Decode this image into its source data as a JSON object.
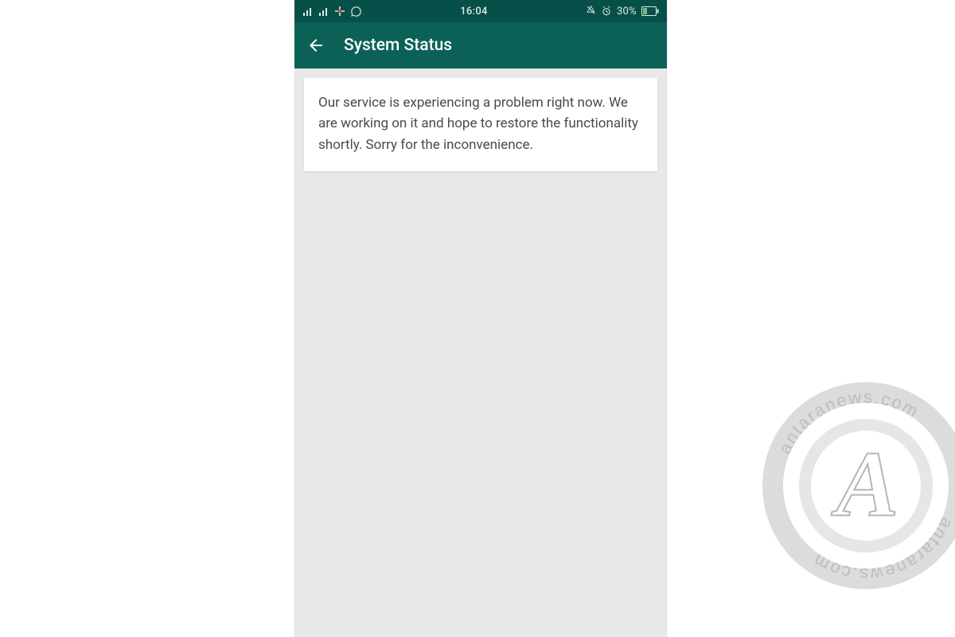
{
  "colors": {
    "status_bar_bg": "#075049",
    "app_bar_bg": "#0c6157",
    "content_bg": "#e8e8e8",
    "card_bg": "#ffffff",
    "card_text": "#4a4a4a"
  },
  "status_bar": {
    "time": "16:04",
    "battery_text": "30%",
    "icons": {
      "signal1": "signal-icon",
      "signal2": "signal-icon",
      "no_data": "no-data-icon",
      "whatsapp": "whatsapp-icon",
      "alarm": "alarm-icon",
      "battery": "battery-icon"
    }
  },
  "app_bar": {
    "title": "System Status",
    "back_icon": "back-arrow-icon"
  },
  "card": {
    "message": "Our service is experiencing a problem right now. We are working on it and hope to restore the functionality shortly. Sorry for the inconvenience."
  },
  "watermark": {
    "text": "antaranews.com",
    "glyph": "A"
  }
}
